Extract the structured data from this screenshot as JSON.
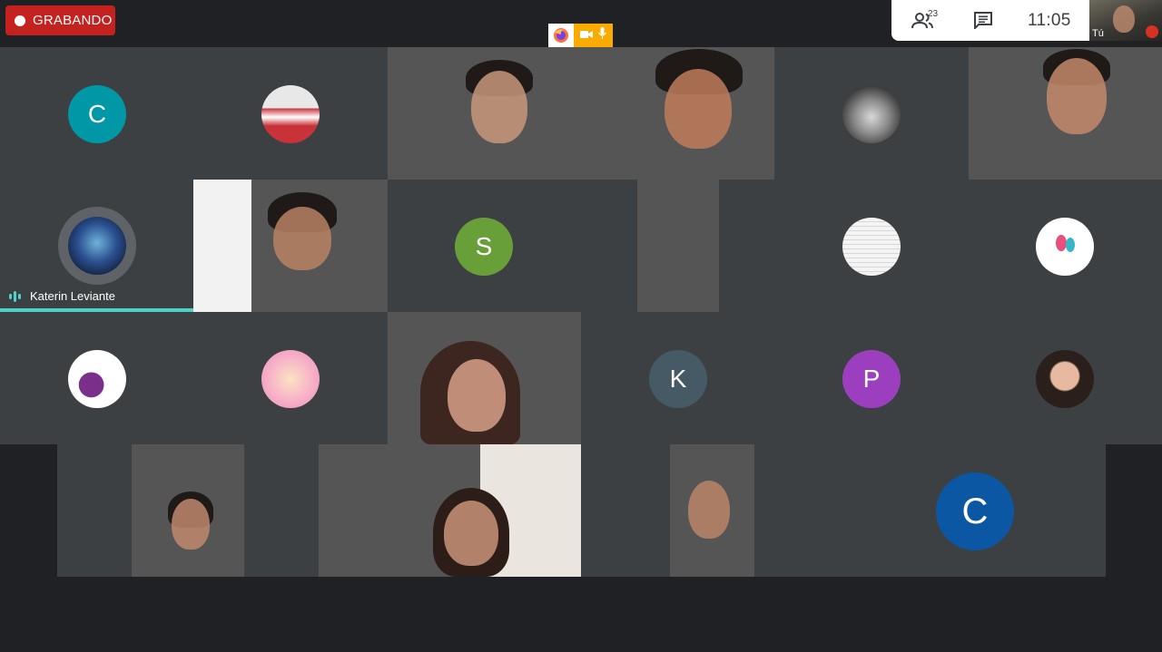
{
  "recording": {
    "label": "GRABANDO"
  },
  "topbar": {
    "participant_count": "23",
    "time": "11:05"
  },
  "self_view": {
    "label": "Tú"
  },
  "active_speaker": {
    "name": "Katerin Leviante"
  },
  "avatars": {
    "a1": "C",
    "a2": "S",
    "a3": "K",
    "a4": "P",
    "a5": "C"
  },
  "colors": {
    "recording": "#c5221f",
    "speaking": "#4fd1c5",
    "background": "#202124",
    "tile": "#3c4043"
  },
  "icons": [
    "record-dot-icon",
    "people-icon",
    "chat-icon",
    "firefox-icon",
    "camera-icon",
    "mic-icon",
    "mic-off-icon",
    "audio-bars-icon"
  ]
}
